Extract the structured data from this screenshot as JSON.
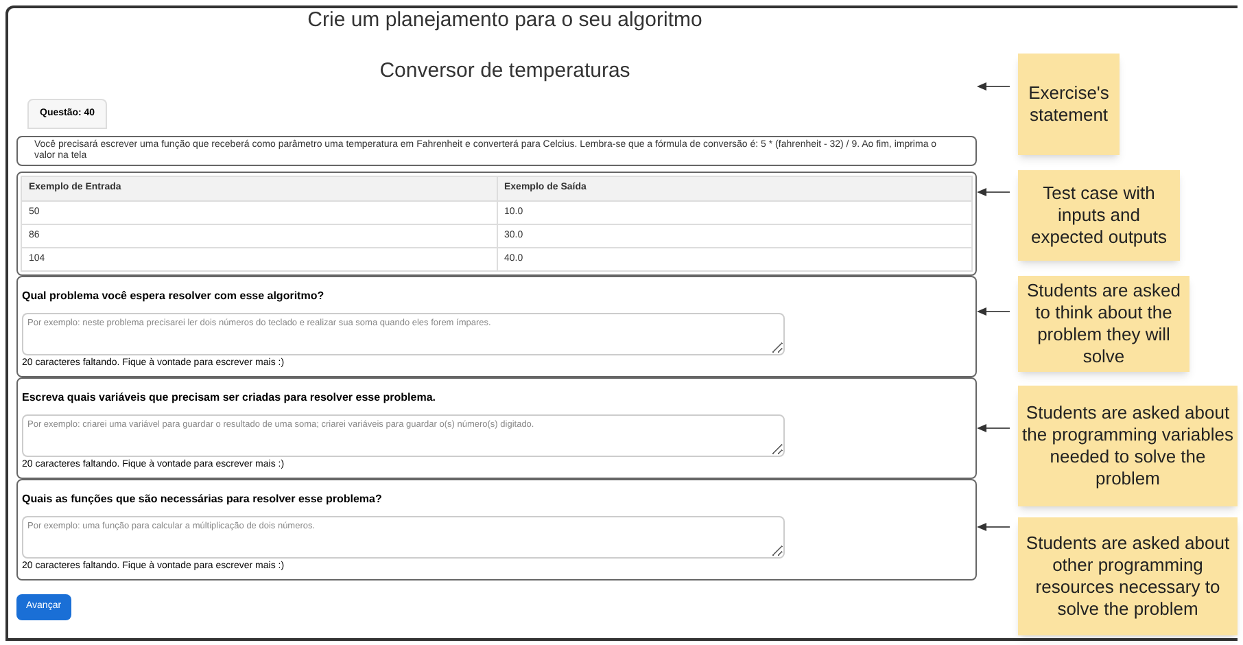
{
  "page_title": "Crie um planejamento para o seu algoritmo",
  "exercise_title": "Conversor de temperaturas",
  "question_tab": "Questão: 40",
  "statement": "Você precisará escrever uma função que receberá como parâmetro uma temperatura em Fahrenheit e converterá para Celcius. Lembra-se que a fórmula de conversão é: 5 * (fahrenheit - 32) / 9. Ao fim, imprima o valor na tela",
  "table": {
    "columns": [
      "Exemplo de Entrada",
      "Exemplo de Saída"
    ],
    "rows": [
      [
        "50",
        "10.0"
      ],
      [
        "86",
        "30.0"
      ],
      [
        "104",
        "40.0"
      ]
    ]
  },
  "questions": [
    {
      "label": "Qual problema você espera resolver com esse algoritmo?",
      "placeholder": "Por exemplo: neste problema precisarei ler dois números do teclado e realizar sua soma quando eles forem ímpares.",
      "counter": "20 caracteres faltando. Fique à vontade para escrever mais :)"
    },
    {
      "label": "Escreva quais variáveis que precisam ser criadas para resolver esse problema.",
      "placeholder": "Por exemplo: criarei uma variável para guardar o resultado de uma soma; criarei variáveis para guardar o(s) número(s) digitado.",
      "counter": "20 caracteres faltando. Fique à vontade para escrever mais :)"
    },
    {
      "label": "Quais as funções que são necessárias para resolver esse problema?",
      "placeholder": "Por exemplo: uma função para calcular a múltiplicação de dois números.",
      "counter": "20 caracteres faltando. Fique à vontade para escrever mais :)"
    }
  ],
  "submit_button": "Avançar",
  "annotations": [
    "Exercise's statement",
    "Test case with inputs and expected outputs",
    "Students are asked to think about the problem they will solve",
    "Students are asked about the programming variables needed to solve the problem",
    "Students are asked about other programming resources necessary to solve the problem"
  ]
}
